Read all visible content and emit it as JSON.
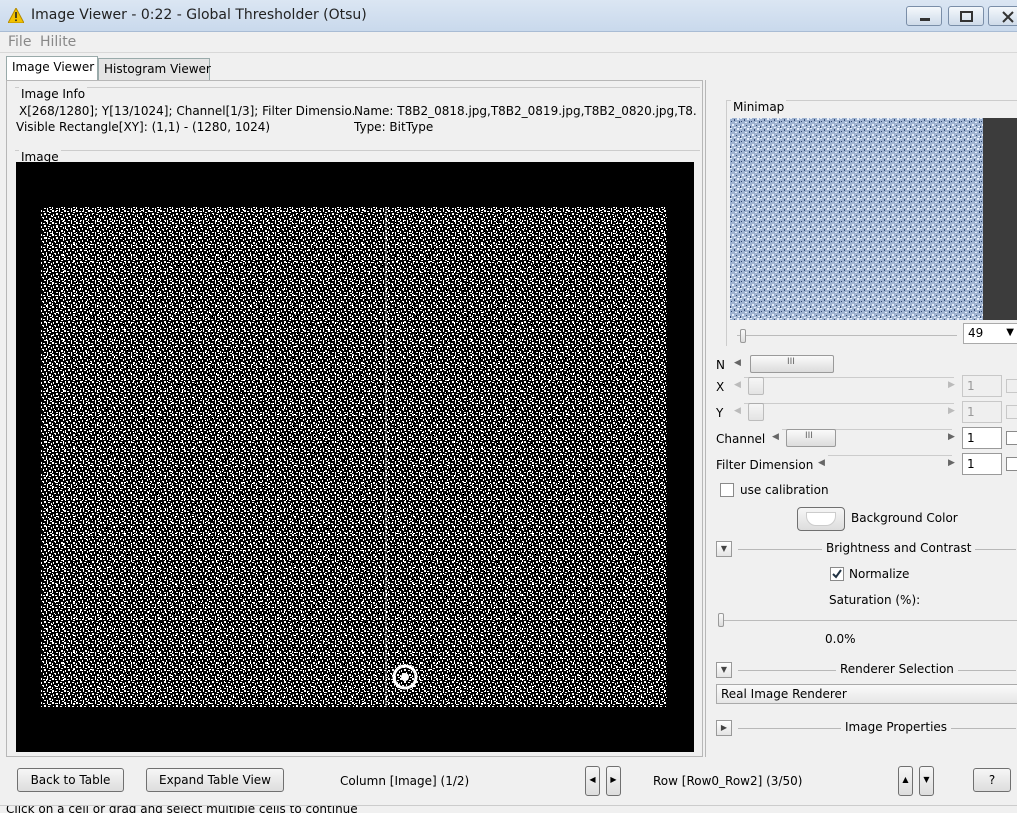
{
  "window": {
    "title": "Image Viewer - 0:22 - Global Thresholder (Otsu)",
    "controls": [
      "minimize-icon",
      "maximize-icon",
      "close-icon"
    ]
  },
  "menu": {
    "items": [
      "File",
      "Hilite"
    ]
  },
  "tabs": [
    {
      "label": "Image Viewer",
      "active": true
    },
    {
      "label": "Histogram Viewer",
      "active": false
    }
  ],
  "image_info": {
    "legend": "Image Info",
    "line1_left": "X[268/1280]; Y[13/1024]; Channel[1/3]; Filter Dimensio...",
    "line1_right": "Name: T8B2_0818.jpg,T8B2_0819.jpg,T8B2_0820.jpg,T8...",
    "line2_left": "Visible Rectangle[XY]: (1,1) - (1280, 1024)",
    "line2_right": "Type: BitType"
  },
  "image_panel": {
    "legend": "Image"
  },
  "minimap": {
    "legend": "Minimap",
    "zoom": "49",
    "colors": {
      "noise_light": "#dce8f8",
      "noise_dark": "#2e4870",
      "frame": "#3c3c3c"
    }
  },
  "dims": {
    "n_label": "N",
    "x_label": "X",
    "x_value": "1",
    "y_label": "Y",
    "y_value": "1",
    "channel_label": "Channel",
    "channel_value": "1",
    "filter_label": "Filter Dimension",
    "filter_value": "1"
  },
  "use_calibration": {
    "label": "use calibration",
    "checked": false
  },
  "background_color": {
    "label": "Background Color"
  },
  "brightness": {
    "section": "Brightness and Contrast",
    "normalize_label": "Normalize",
    "normalize_checked": true,
    "saturation_label": "Saturation (%):",
    "saturation_value": "0.0%"
  },
  "renderer": {
    "section": "Renderer Selection",
    "selected": "Real Image Renderer"
  },
  "image_properties": {
    "section": "Image Properties"
  },
  "bottom": {
    "back_label": "Back to Table",
    "expand_label": "Expand Table View",
    "column_text": "Column [Image] (1/2)",
    "row_text": "Row [Row0_Row2] (3/50)",
    "help_label": "?"
  },
  "status": {
    "text": "Click on a cell or drag and select multiple cells to continue"
  }
}
